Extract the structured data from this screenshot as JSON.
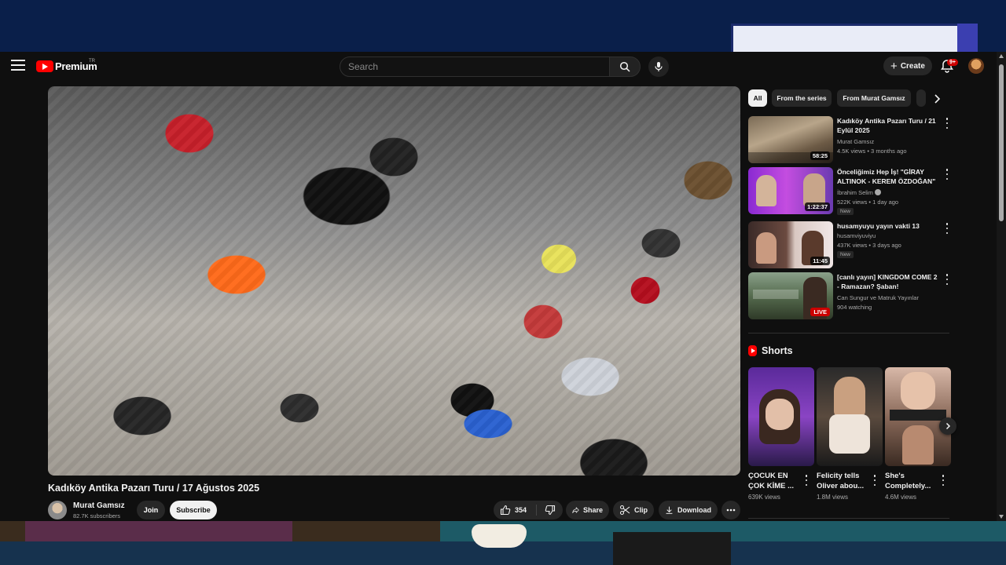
{
  "header": {
    "logo_text": "Premium",
    "country_code": "TR",
    "search_placeholder": "Search",
    "create_label": "Create",
    "notification_count": "9+"
  },
  "video": {
    "title": "Kadıköy Antika Pazarı Turu / 17 Ağustos 2025",
    "channel_name": "Murat Gamsız",
    "subscribers": "82.7K subscribers",
    "join_label": "Join",
    "subscribe_label": "Subscribe",
    "like_count": "354",
    "share_label": "Share",
    "clip_label": "Clip",
    "download_label": "Download"
  },
  "chips": [
    {
      "label": "All",
      "active": true
    },
    {
      "label": "From the series",
      "active": false
    },
    {
      "label": "From Murat Gamsız",
      "active": false
    }
  ],
  "recommendations": [
    {
      "title": "Kadıköy Antika Pazarı Turu / 21 Eylül 2025",
      "channel": "Murat Gamsız",
      "meta": "4.5K views • 3 months ago",
      "duration": "58:25"
    },
    {
      "title": "Önceliğimiz Hep İş! \"GİRAY ALTINOK - KEREM ÖZDOĞAN\" ...",
      "channel": "İbrahim Selim",
      "meta": "522K views • 1 day ago",
      "badge": "New",
      "duration": "1:22:37"
    },
    {
      "title": "husamyuyu yayın vakti 13",
      "channel": "husamviyuviyu",
      "meta": "437K views • 3 days ago",
      "badge": "New",
      "duration": "11:45"
    },
    {
      "title": "[canlı yayın] KINGDOM COME 2 - Ramazan? Şaban!",
      "channel": "Can Sungur ve Matruk Yayınlar",
      "meta": "904 watching",
      "live_label": "LIVE"
    }
  ],
  "shorts": {
    "heading": "Shorts",
    "items": [
      {
        "title": "ÇOCUK EN ÇOK KİME ...",
        "views": "639K views"
      },
      {
        "title": "Felicity tells Oliver abou...",
        "views": "1.8M views"
      },
      {
        "title": "She's Completely...",
        "views": "4.6M views"
      }
    ]
  },
  "icons": {
    "menu": "hamburger-menu-icon",
    "search": "search-icon",
    "mic": "microphone-icon",
    "bell": "bell-icon",
    "like": "thumbs-up-icon",
    "dislike": "thumbs-down-icon",
    "share": "share-arrow-icon",
    "clip": "scissors-icon",
    "download": "download-icon",
    "more": "more-horizontal-icon"
  },
  "colors": {
    "brand_red": "#ff0000",
    "background": "#0f0f0f",
    "live_red": "#cc0000"
  }
}
